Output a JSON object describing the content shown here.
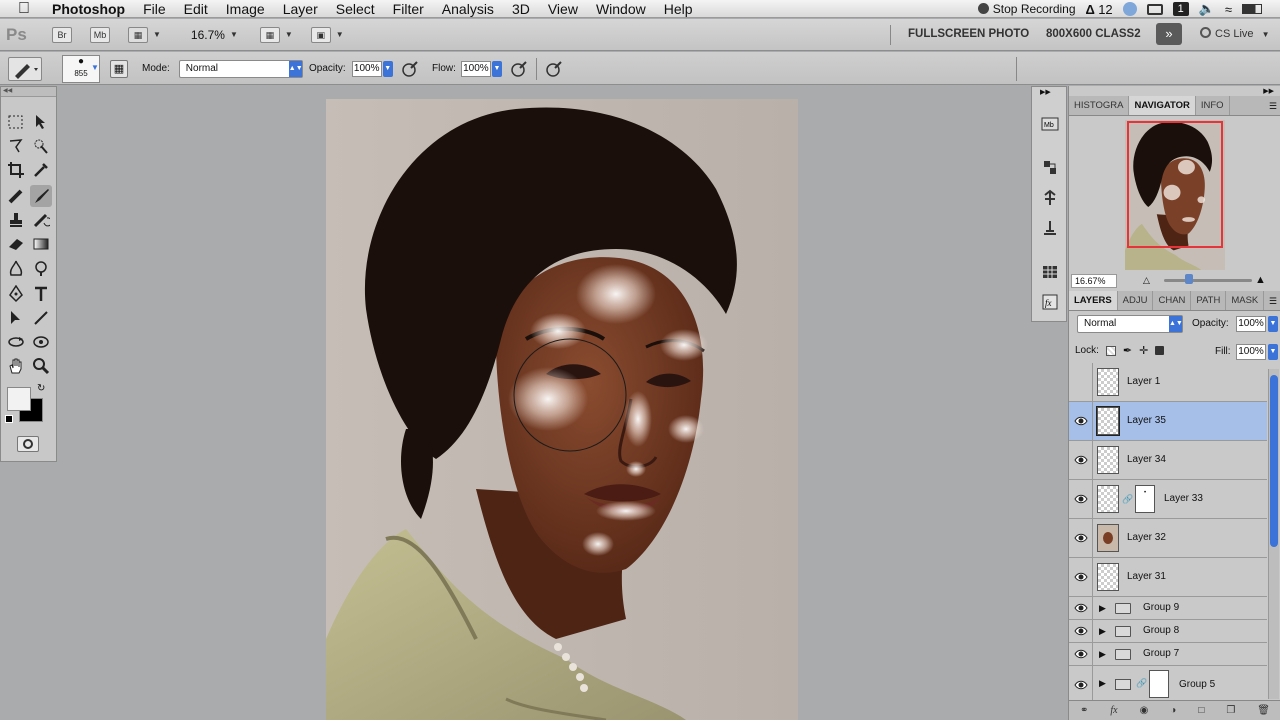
{
  "menubar": {
    "app": "Photoshop",
    "items": [
      "File",
      "Edit",
      "Image",
      "Layer",
      "Select",
      "Filter",
      "Analysis",
      "3D",
      "View",
      "Window",
      "Help"
    ],
    "stop_recording": "Stop Recording",
    "adobe_badge": "12",
    "badge_1": "1"
  },
  "appbar": {
    "logo": "Ps",
    "btn_br": "Br",
    "btn_mb": "Mb",
    "zoom": "16.7%",
    "workspace_1": "FULLSCREEN PHOTO",
    "workspace_2": "800X600 CLASS2",
    "more": "»",
    "cs_live": "CS Live"
  },
  "options": {
    "brush_size": "855",
    "mode_label": "Mode:",
    "mode_value": "Normal",
    "opacity_label": "Opacity:",
    "opacity_value": "100%",
    "flow_label": "Flow:",
    "flow_value": "100%"
  },
  "navigator": {
    "tabs": [
      "HISTOGRA",
      "NAVIGATOR",
      "INFO"
    ],
    "active_tab": "NAVIGATOR",
    "zoom": "16.67%"
  },
  "layers_panel": {
    "tabs": [
      "LAYERS",
      "ADJU",
      "CHAN",
      "PATH",
      "MASK"
    ],
    "active_tab": "LAYERS",
    "blend_mode": "Normal",
    "opacity_label": "Opacity:",
    "opacity_value": "100%",
    "lock_label": "Lock:",
    "fill_label": "Fill:",
    "fill_value": "100%",
    "layers": [
      {
        "name": "Layer 1",
        "visible": false,
        "selected": false,
        "type": "layer"
      },
      {
        "name": "Layer 35",
        "visible": true,
        "selected": true,
        "type": "layer"
      },
      {
        "name": "Layer 34",
        "visible": true,
        "selected": false,
        "type": "layer"
      },
      {
        "name": "Layer 33",
        "visible": true,
        "selected": false,
        "type": "masked"
      },
      {
        "name": "Layer 32",
        "visible": true,
        "selected": false,
        "type": "portrait"
      },
      {
        "name": "Layer 31",
        "visible": true,
        "selected": false,
        "type": "layer"
      },
      {
        "name": "Group 9",
        "visible": true,
        "selected": false,
        "type": "group"
      },
      {
        "name": "Group 8",
        "visible": true,
        "selected": false,
        "type": "group"
      },
      {
        "name": "Group 7",
        "visible": true,
        "selected": false,
        "type": "group"
      },
      {
        "name": "Group 5",
        "visible": true,
        "selected": false,
        "type": "group-mask"
      }
    ]
  },
  "colors": {
    "accent": "#3b73d8",
    "selection": "#a5bfe8",
    "navigator_frame": "#e5353a",
    "foreground": "#f2f2f2",
    "background": "#000000"
  }
}
